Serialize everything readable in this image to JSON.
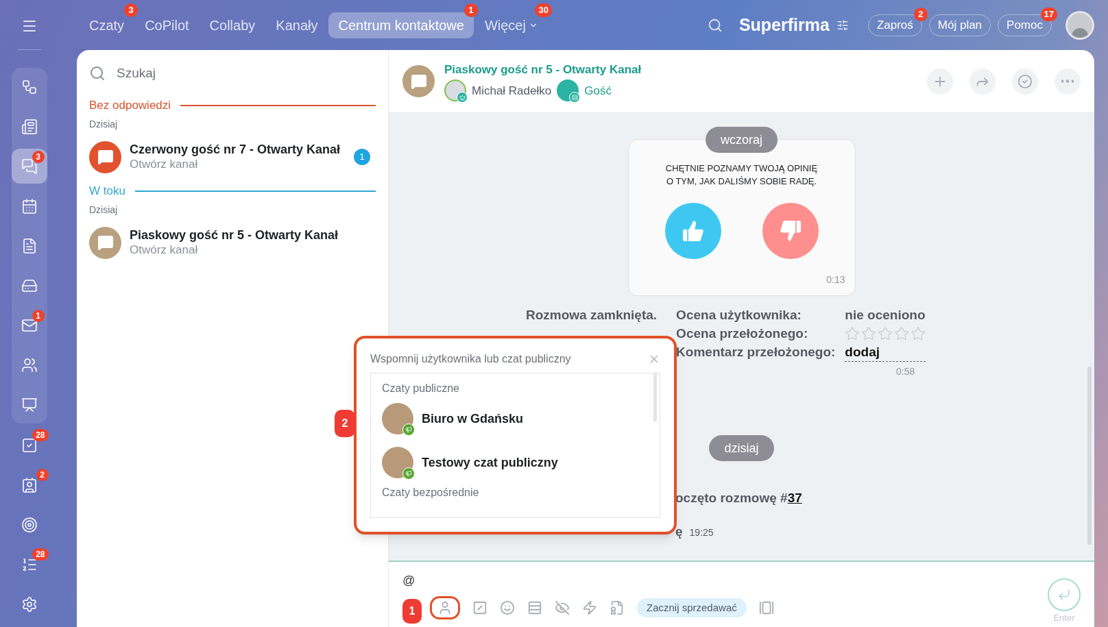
{
  "top_nav": {
    "tabs": [
      {
        "label": "Czaty",
        "selected": false,
        "badge": "3"
      },
      {
        "label": "CoPilot",
        "selected": false
      },
      {
        "label": "Collaby",
        "selected": false
      },
      {
        "label": "Kanały",
        "selected": false
      },
      {
        "label": "Centrum kontaktowe",
        "selected": true,
        "badge": "1"
      },
      {
        "label": "Więcej",
        "selected": false,
        "badge": "30",
        "dropdown": true
      }
    ],
    "company": "Superfirma",
    "buttons": [
      {
        "label": "Zaproś",
        "badge": "2"
      },
      {
        "label": "Mój plan"
      },
      {
        "label": "Pomoc",
        "badge": "17"
      }
    ]
  },
  "rail": {
    "items": [
      {
        "kind": "flow",
        "selected": false
      },
      {
        "kind": "feed",
        "selected": false
      },
      {
        "kind": "chats",
        "selected": true,
        "badge": "3"
      },
      {
        "kind": "calendar",
        "selected": false
      },
      {
        "kind": "document",
        "selected": false
      },
      {
        "kind": "drive",
        "selected": false
      },
      {
        "kind": "mail",
        "selected": false,
        "badge": "1"
      },
      {
        "kind": "people",
        "selected": false
      },
      {
        "kind": "board",
        "selected": false
      },
      {
        "kind": "tasks",
        "selected": false,
        "badge": "28"
      },
      {
        "kind": "crm",
        "selected": false,
        "badge": "2"
      },
      {
        "kind": "target",
        "selected": false
      },
      {
        "kind": "list",
        "selected": false,
        "badge": "28"
      },
      {
        "kind": "settings",
        "selected": false
      }
    ]
  },
  "chat_list": {
    "search": {
      "placeholder": "Szukaj"
    },
    "groups": [
      {
        "title": "Bez odpowiedzi",
        "color": "#d9542c",
        "day": "Dzisiaj",
        "items": [
          {
            "name": "Czerwony gość nr 7 - Otwarty Kanał",
            "subtitle": "Otwórz kanał",
            "color": "#e2522e",
            "counter": "1"
          }
        ]
      },
      {
        "title": "W toku",
        "color": "#2fa7cf",
        "day": "Dzisiaj",
        "items": [
          {
            "name": "Piaskowy gość nr 5 - Otwarty Kanał",
            "subtitle": "Otwórz kanał",
            "color": "#b9a17f"
          }
        ]
      }
    ]
  },
  "chat": {
    "title": "Piaskowy gość nr 5 - Otwarty Kanał",
    "participants": [
      {
        "name": "Michał Radełko",
        "kind": "operator"
      },
      {
        "name": "Gość",
        "kind": "guest"
      }
    ],
    "messages": [
      {
        "kind": "date",
        "text": "wczoraj"
      },
      {
        "kind": "rating",
        "text_lines": [
          "CHĘTNIE POZNAMY TWOJĄ OPINIĘ",
          "O TYM, JAK DALIŚMY SOBIE RADĘ."
        ],
        "time": "0:13"
      },
      {
        "kind": "summary",
        "status": "Rozmowa zamknięta.",
        "user_rating_label": "Ocena użytkownika:",
        "user_rating": "nie oceniono",
        "supervisor_rating_label": "Ocena przełożonego:",
        "stars": 0,
        "comment_label": "Komentarz przełożonego:",
        "comment_link": "dodaj",
        "time": "0:58"
      },
      {
        "kind": "date",
        "text": "dzisiaj"
      },
      {
        "kind": "system",
        "text": "oczęto rozmowę #",
        "link": "37"
      },
      {
        "kind": "system_time",
        "text": "ę",
        "time": "19:25"
      }
    ],
    "composer": {
      "value": "@",
      "chip": "Zacznij sprzedawać",
      "send_label": "Enter"
    }
  },
  "mention_popup": {
    "title": "Wspomnij użytkownika lub czat publiczny",
    "sections": [
      {
        "title": "Czaty publiczne",
        "items": [
          {
            "name": "Biuro w Gdańsku"
          },
          {
            "name": "Testowy czat publiczny"
          }
        ]
      },
      {
        "title": "Czaty bezpośrednie"
      }
    ]
  },
  "callouts": [
    "1",
    "2"
  ]
}
